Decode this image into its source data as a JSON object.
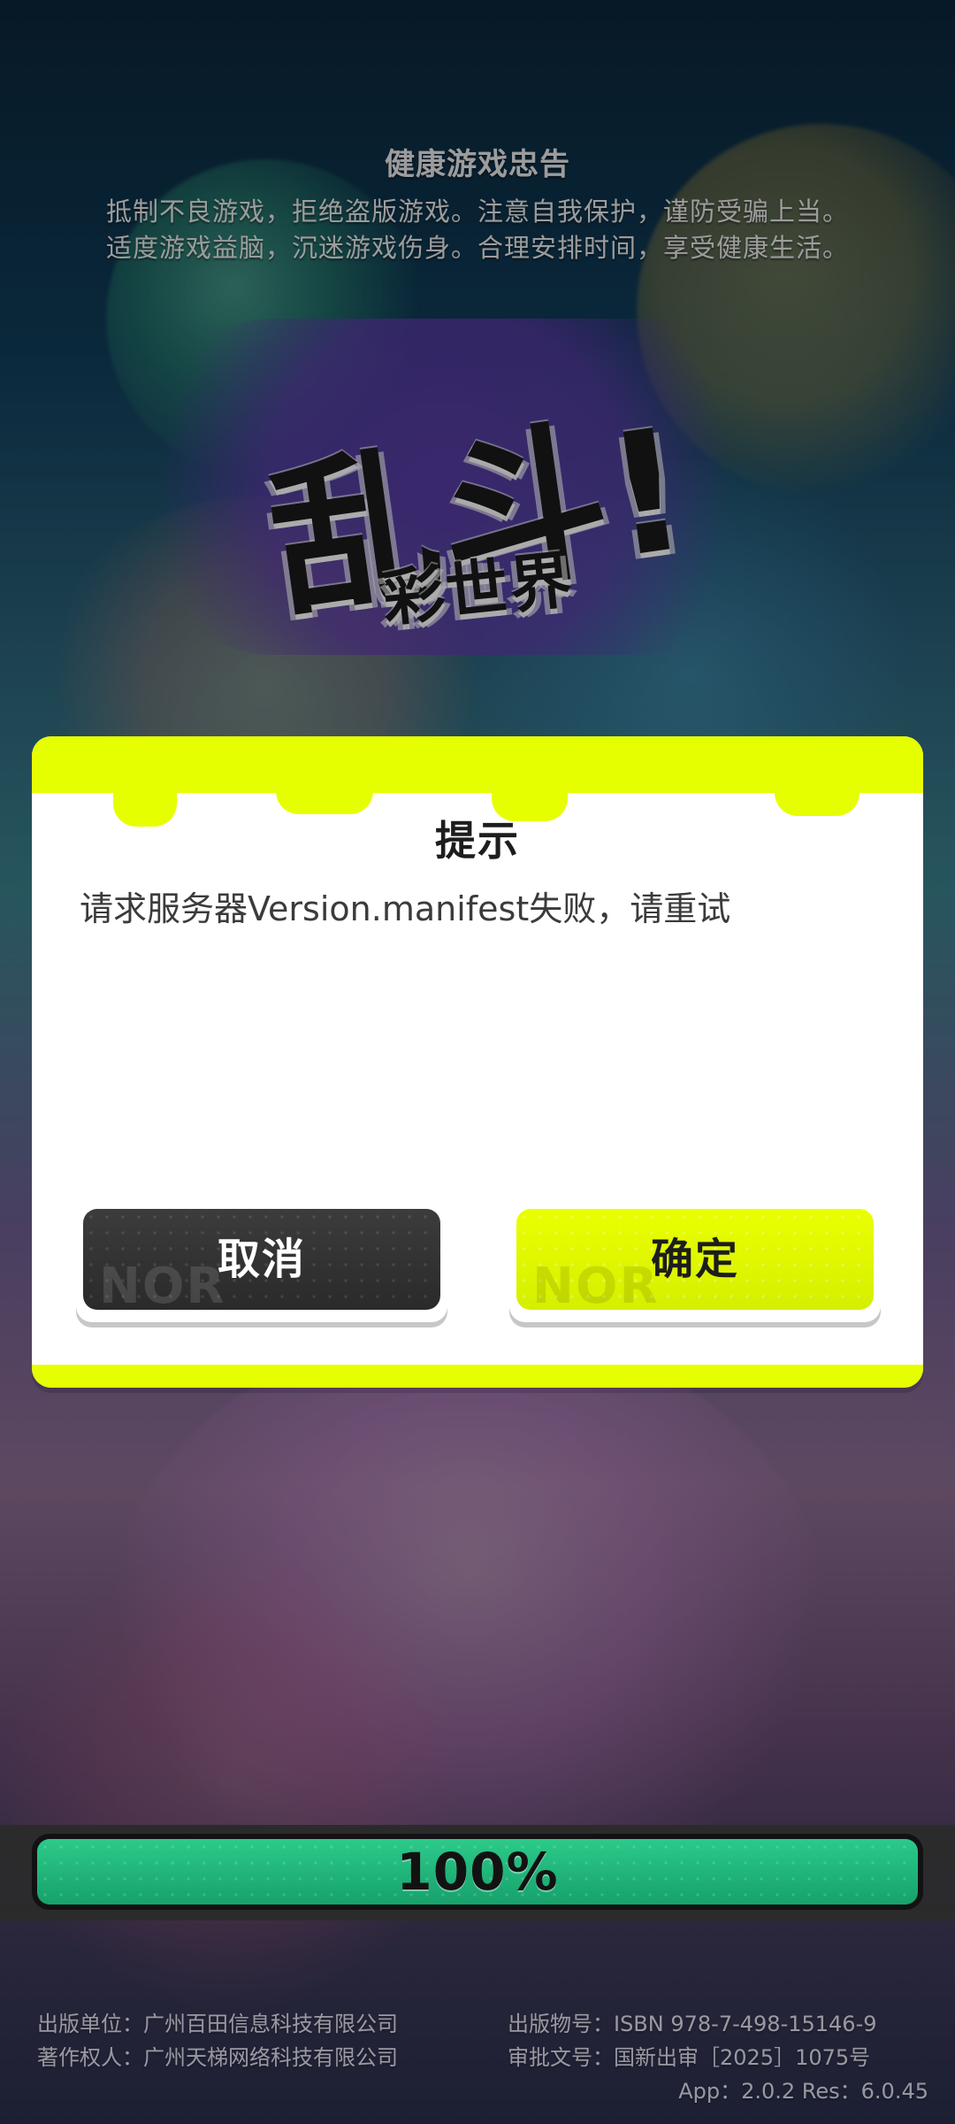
{
  "advisory": {
    "title": "健康游戏忠告",
    "lines": [
      "抵制不良游戏，拒绝盗版游戏。注意自我保护，谨防受骗上当。",
      "适度游戏益脑，沉迷游戏伤身。合理安排时间，享受健康生活。"
    ]
  },
  "logo": {
    "main": "乱斗!",
    "sub": "彩世界"
  },
  "dialog": {
    "title": "提示",
    "message": "请求服务器Version.manifest失败，请重试",
    "buttons": {
      "cancel": "取消",
      "confirm": "确定"
    }
  },
  "progress": {
    "value": 1.0,
    "label": "100%"
  },
  "footer": {
    "left_lines": [
      "出版单位：广州百田信息科技有限公司",
      "著作权人：广州天梯网络科技有限公司"
    ],
    "right_lines": [
      "出版物号：ISBN 978-7-498-15146-9",
      "审批文号：国新出审［2025］1075号"
    ],
    "version": "App：2.0.2 Res：6.0.45"
  },
  "colors": {
    "accent": "#e6ff00",
    "cancel_button": "#2f2f2f",
    "progress_fill": "#1fbf7b"
  }
}
